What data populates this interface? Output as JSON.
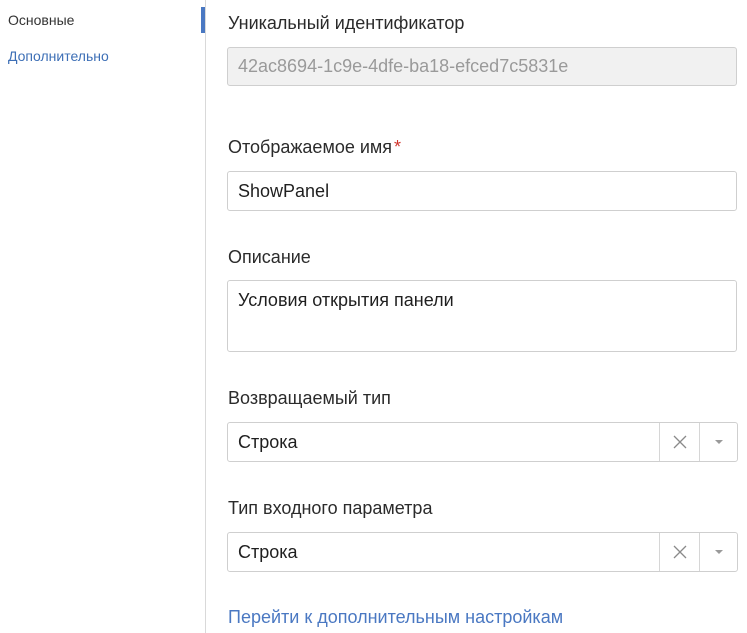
{
  "nav": {
    "items": [
      {
        "label": "Основные",
        "active": true
      },
      {
        "label": "Дополнительно",
        "active": false
      }
    ]
  },
  "form": {
    "uid": {
      "label": "Уникальный идентификатор",
      "value": "42ac8694-1c9e-4dfe-ba18-efced7c5831e"
    },
    "display_name": {
      "label": "Отображаемое имя",
      "required_mark": "*",
      "value": "ShowPanel"
    },
    "description": {
      "label": "Описание",
      "value": "Условия открытия панели"
    },
    "return_type": {
      "label": "Возвращаемый тип",
      "value": "Строка"
    },
    "input_param_type": {
      "label": "Тип входного параметра",
      "value": "Строка"
    },
    "advanced_link": "Перейти к дополнительным настройкам"
  },
  "colors": {
    "accent": "#4a78c2",
    "required": "#d0342c",
    "readonly_bg": "#f1f1f1",
    "border": "#cfcfcf"
  },
  "icons": {
    "clear": "clear-x-icon",
    "dropdown": "caret-down-icon"
  }
}
